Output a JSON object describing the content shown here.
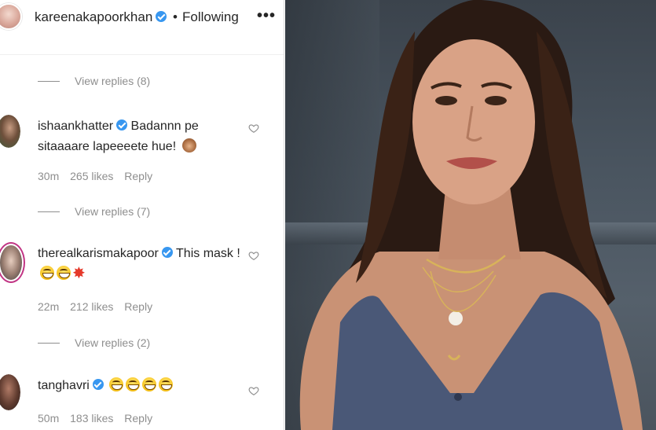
{
  "post": {
    "username": "kareenakapoorkhan",
    "separator": "•",
    "follow_status": "Following",
    "more_label": "•••"
  },
  "threads": [
    {
      "view_replies": "View replies (8)"
    },
    {
      "username": "ishaankhatter",
      "text": "Badannn pe sitaaaare lapeeeete hue!",
      "emojis": [
        "see-no-evil-monkey"
      ],
      "time": "30m",
      "likes": "265 likes",
      "reply": "Reply",
      "view_replies": "View replies (7)"
    },
    {
      "username": "therealkarismakapoor",
      "text": "This mask !",
      "emojis": [
        "grinning-face",
        "grinning-face",
        "collision"
      ],
      "time": "22m",
      "likes": "212 likes",
      "reply": "Reply",
      "view_replies": "View replies (2)"
    },
    {
      "username": "tanghavri",
      "text": "",
      "emojis": [
        "grinning-face",
        "grinning-face",
        "grinning-face",
        "grinning-face"
      ],
      "time": "50m",
      "likes": "183 likes",
      "reply": "Reply"
    }
  ],
  "colors": {
    "verified": "#3897f0",
    "muted_text": "#8e8e8e",
    "story_ring": "#c13584"
  }
}
